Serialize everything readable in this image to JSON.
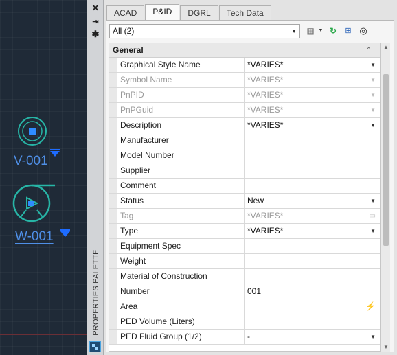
{
  "canvas": {
    "tags": [
      {
        "label": "V-001"
      },
      {
        "label": "W-001"
      }
    ],
    "colors": {
      "symbol": "#27b5a6",
      "tag": "#4f8fe6",
      "triangle": "#1e6cff"
    }
  },
  "palette": {
    "side_title": "PROPERTIES PALETTE",
    "side_icons": [
      "close-icon",
      "auto-hide-icon",
      "settings-icon"
    ],
    "tabs": [
      {
        "label": "ACAD",
        "active": false
      },
      {
        "label": "P&ID",
        "active": true
      },
      {
        "label": "DGRL",
        "active": false
      },
      {
        "label": "Tech Data",
        "active": false
      }
    ],
    "selection": "All (2)",
    "toolbar_icons": [
      "quick-select-icon",
      "toggle-pickadd-icon",
      "select-objects-icon",
      "hide-show-icon"
    ],
    "category": "General",
    "rows": [
      {
        "name": "Graphical Style Name",
        "value": "*VARIES*",
        "control": "dropdown",
        "disabled": false
      },
      {
        "name": "Symbol Name",
        "value": "*VARIES*",
        "control": "dropdown",
        "disabled": true
      },
      {
        "name": "PnPID",
        "value": "*VARIES*",
        "control": "dropdown",
        "disabled": true
      },
      {
        "name": "PnPGuid",
        "value": "*VARIES*",
        "control": "dropdown",
        "disabled": true
      },
      {
        "name": "Description",
        "value": "*VARIES*",
        "control": "dropdown",
        "disabled": false
      },
      {
        "name": "Manufacturer",
        "value": "",
        "control": "none",
        "disabled": false
      },
      {
        "name": "Model Number",
        "value": "",
        "control": "none",
        "disabled": false
      },
      {
        "name": "Supplier",
        "value": "",
        "control": "none",
        "disabled": false
      },
      {
        "name": "Comment",
        "value": "",
        "control": "none",
        "disabled": false
      },
      {
        "name": "Status",
        "value": "New",
        "control": "dropdown",
        "disabled": false
      },
      {
        "name": "Tag",
        "value": "*VARIES*",
        "control": "tag",
        "disabled": true
      },
      {
        "name": "Type",
        "value": "*VARIES*",
        "control": "dropdown",
        "disabled": false
      },
      {
        "name": "Equipment Spec",
        "value": "",
        "control": "none",
        "disabled": false
      },
      {
        "name": "Weight",
        "value": "",
        "control": "none",
        "disabled": false
      },
      {
        "name": "Material of Construction",
        "value": "",
        "control": "none",
        "disabled": false
      },
      {
        "name": "Number",
        "value": "001",
        "control": "none",
        "disabled": false
      },
      {
        "name": "Area",
        "value": "",
        "control": "bolt",
        "disabled": false
      },
      {
        "name": "PED Volume (Liters)",
        "value": "",
        "control": "none",
        "disabled": false
      },
      {
        "name": "PED Fluid Group (1/2)",
        "value": "-",
        "control": "dropdown",
        "disabled": false
      }
    ]
  }
}
